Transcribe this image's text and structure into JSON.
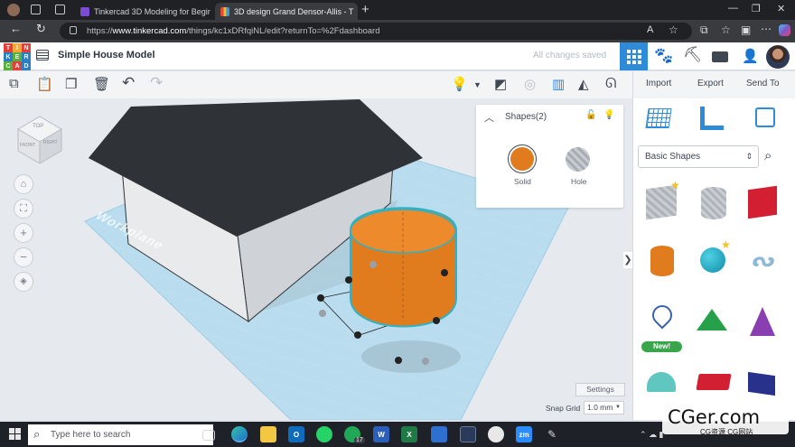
{
  "browser": {
    "tabs": [
      {
        "label": "Tinkercad 3D Modeling for Begin",
        "active": false
      },
      {
        "label": "3D design Grand Densor-Allis - T",
        "active": true
      }
    ],
    "url_prefix": "https://",
    "url_domain": "www.tinkercad.com",
    "url_rest": "/things/kc1xDRfqiNL/edit?returnTo=%2Fdashboard"
  },
  "app": {
    "logo_letters": [
      "T",
      "I",
      "N",
      "K",
      "E",
      "R",
      "C",
      "A",
      "D"
    ],
    "title": "Simple House Model",
    "save_status": "All changes saved"
  },
  "toolbar": {
    "import_label": "Import",
    "export_label": "Export",
    "send_to_label": "Send To"
  },
  "viewcube": {
    "top": "TOP",
    "front": "FRONT",
    "right": "RIGHT"
  },
  "shapes_panel": {
    "title": "Shapes(2)",
    "solid_label": "Solid",
    "hole_label": "Hole",
    "solid_color": "#e07b1e"
  },
  "workplane": {
    "label": "Workplane",
    "settings_label": "Settings",
    "snap_grid_label": "Snap Grid",
    "snap_grid_value": "1.0 mm"
  },
  "library": {
    "category": "Basic Shapes",
    "new_badge": "New!"
  },
  "taskbar": {
    "search_placeholder": "Type here to search",
    "whatsapp_badge": "17"
  },
  "watermark": {
    "main": "CGer.com",
    "sub": "CG资源 CG网站"
  },
  "colors": {
    "accent_blue": "#2e8bd8",
    "orange": "#e07b1e",
    "roof": "#2f3236"
  }
}
